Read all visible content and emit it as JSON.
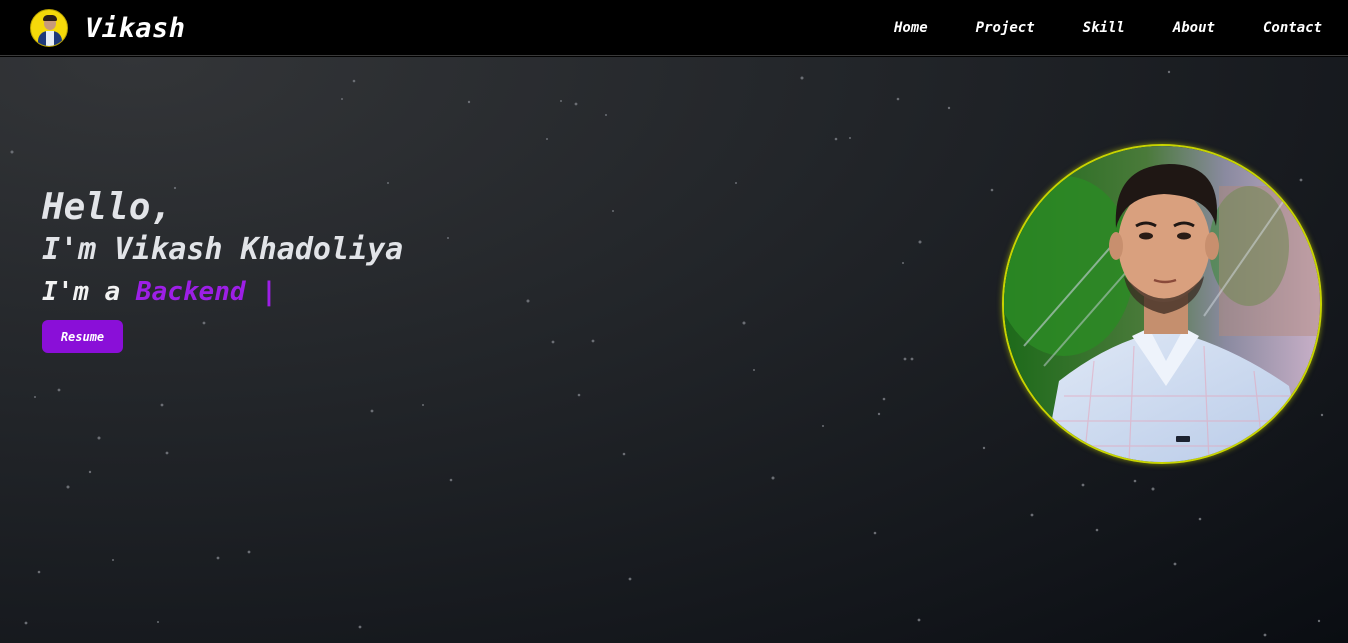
{
  "brand": {
    "name": "Vikash",
    "avatar_icon": "profile-avatar"
  },
  "nav": {
    "items": [
      "Home",
      "Project",
      "Skill",
      "About",
      "Contact"
    ]
  },
  "hero": {
    "greeting": "Hello,",
    "intro": "I'm Vikash Khadoliya",
    "role_prefix": "I'm a ",
    "role_word": "Backend",
    "role_cursor": " |",
    "resume_label": "Resume",
    "photo_icon": "profile-photo"
  },
  "colors": {
    "accent_purple": "#8a0fd8",
    "role_text": "#9d1fe6",
    "photo_border": "#c8d400",
    "navbar_bg": "#000000"
  }
}
